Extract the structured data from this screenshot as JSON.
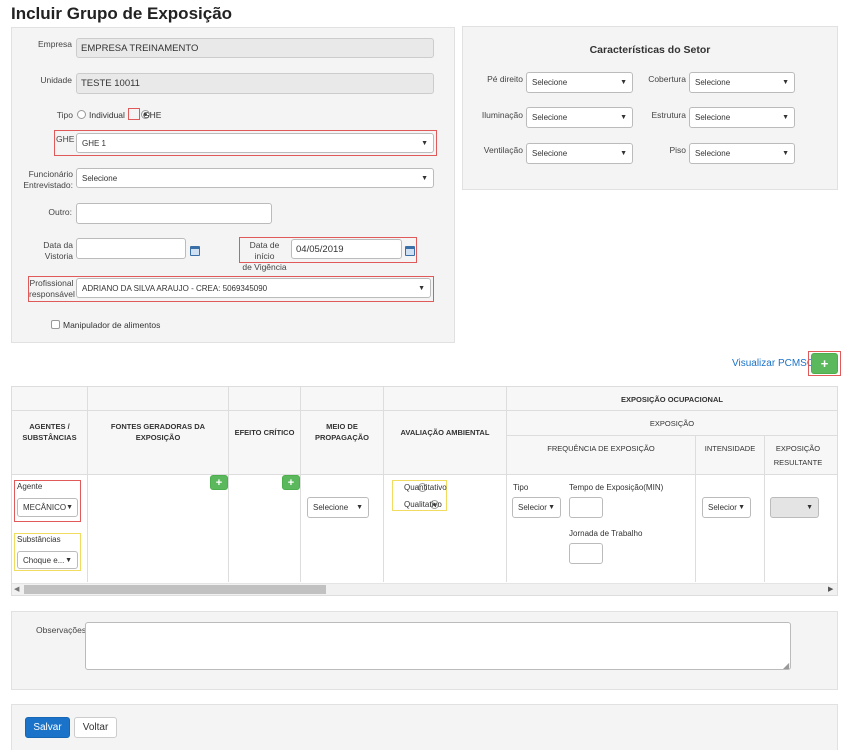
{
  "page": {
    "title": "Incluir Grupo de Exposição"
  },
  "form": {
    "empresa_label": "Empresa",
    "empresa_value": "EMPRESA TREINAMENTO",
    "unidade_label": "Unidade",
    "unidade_value": "TESTE 10011",
    "tipo_label": "Tipo",
    "tipo_individual": "Individual",
    "tipo_ghe": "GHE",
    "ghe_label": "GHE",
    "ghe_value": "GHE 1",
    "funcionario_label_1": "Funcionário",
    "funcionario_label_2": "Entrevistado:",
    "funcionario_value": "Selecione",
    "outro_label": "Outro:",
    "outro_value": "",
    "data_vistoria_label_1": "Data da",
    "data_vistoria_label_2": "Vistoria",
    "data_vistoria_value": "",
    "data_inicio_label_1": "Data de início",
    "data_inicio_label_2": "de Vigência",
    "data_inicio_value": "04/05/2019",
    "profissional_label_1": "Profissional",
    "profissional_label_2": "responsável",
    "profissional_value": "ADRIANO DA SILVA ARAUJO - CREA: 5069345090",
    "manipulador_label": "Manipulador de alimentos"
  },
  "setor": {
    "title": "Características do Setor",
    "pe_direito_label": "Pé direito",
    "pe_direito_value": "Selecione",
    "cobertura_label": "Cobertura",
    "cobertura_value": "Selecione",
    "iluminacao_label": "Iluminação",
    "iluminacao_value": "Selecione",
    "estrutura_label": "Estrutura",
    "estrutura_value": "Selecione",
    "ventilacao_label": "Ventilação",
    "ventilacao_value": "Selecione",
    "piso_label": "Piso",
    "piso_value": "Selecione"
  },
  "actions": {
    "visualizar_pcmso": "Visualizar PCMSO",
    "add_symbol": "+"
  },
  "table": {
    "h_agentes_1": "AGENTES /",
    "h_agentes_2": "SUBSTÂNCIAS",
    "h_fontes_1": "FONTES GERADORAS DA",
    "h_fontes_2": "EXPOSIÇÃO",
    "h_efeito": "EFEITO CRÍTICO",
    "h_meio_1": "MEIO DE",
    "h_meio_2": "PROPAGAÇÃO",
    "h_avaliacao": "AVALIAÇÃO AMBIENTAL",
    "h_exposicao_ocupacional": "EXPOSIÇÃO OCUPACIONAL",
    "h_exposicao": "EXPOSIÇÃO",
    "h_frequencia": "FREQUÊNCIA DE EXPOSIÇÃO",
    "h_intensidade": "INTENSIDADE",
    "h_exp_result_1": "EXPOSIÇÃO",
    "h_exp_result_2": "RESULTANTE",
    "agente_label": "Agente",
    "agente_value": "MECÂNICO",
    "substancias_label": "Substâncias",
    "substancias_value": "Choque e...",
    "meio_value": "Selecione",
    "quantitativo": "Quantitativo",
    "qualitativo": "Qualitativo",
    "tipo_label": "Tipo",
    "tipo_value": "Selecior",
    "tempo_label": "Tempo de Exposição(MIN)",
    "jornada_label": "Jornada de Trabalho",
    "intensidade_value": "Selecior"
  },
  "obs": {
    "label": "Observações",
    "value": ""
  },
  "buttons": {
    "salvar": "Salvar",
    "voltar": "Voltar"
  },
  "colors": {
    "primary": "#1a73c9",
    "success": "#5cb85c",
    "highlight": "#e05a5a",
    "warn": "#f1dc5f"
  }
}
